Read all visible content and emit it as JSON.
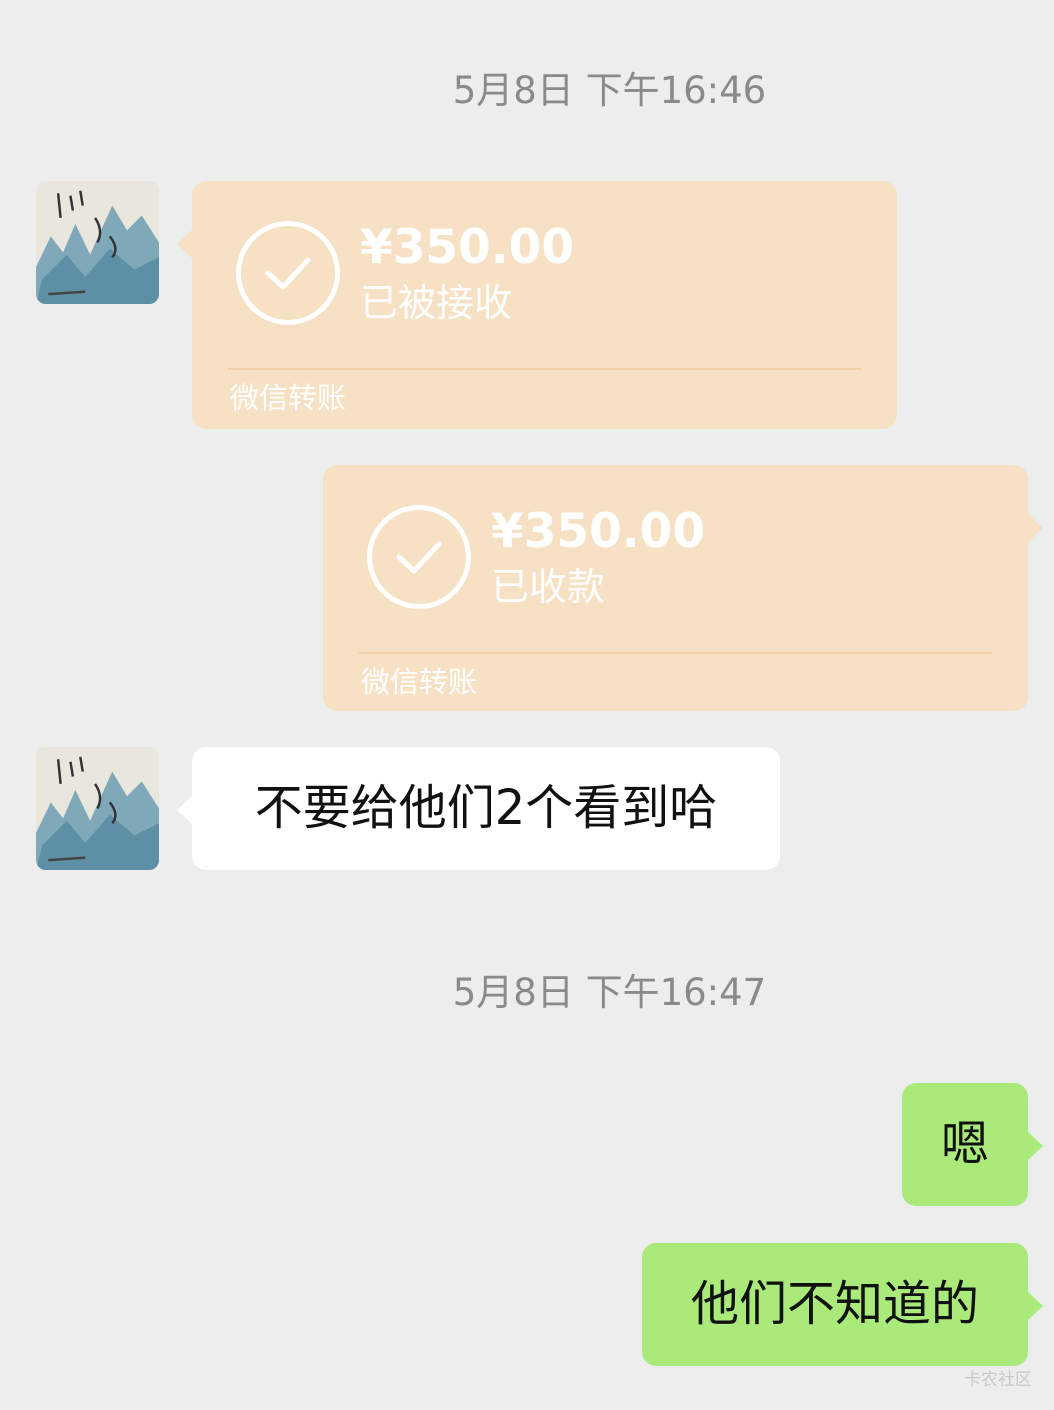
{
  "chat": {
    "timestamp_1": "5月8日 下午16:46",
    "transfer_received": {
      "amount": "¥350.00",
      "status": "已被接收",
      "brand": "微信转账"
    },
    "transfer_collected": {
      "amount": "¥350.00",
      "status": "已收款",
      "brand": "微信转账"
    },
    "message_1": "不要给他们2个看到哈",
    "timestamp_2": "5月8日 下午16:47",
    "reply_1": "嗯",
    "reply_2": "他们不知道的"
  },
  "watermark": "卡农社区",
  "colors": {
    "background": "#ededed",
    "transfer_bubble": "#f7e1c5",
    "sent_bubble": "#a9ea7a",
    "received_bubble": "#ffffff"
  }
}
